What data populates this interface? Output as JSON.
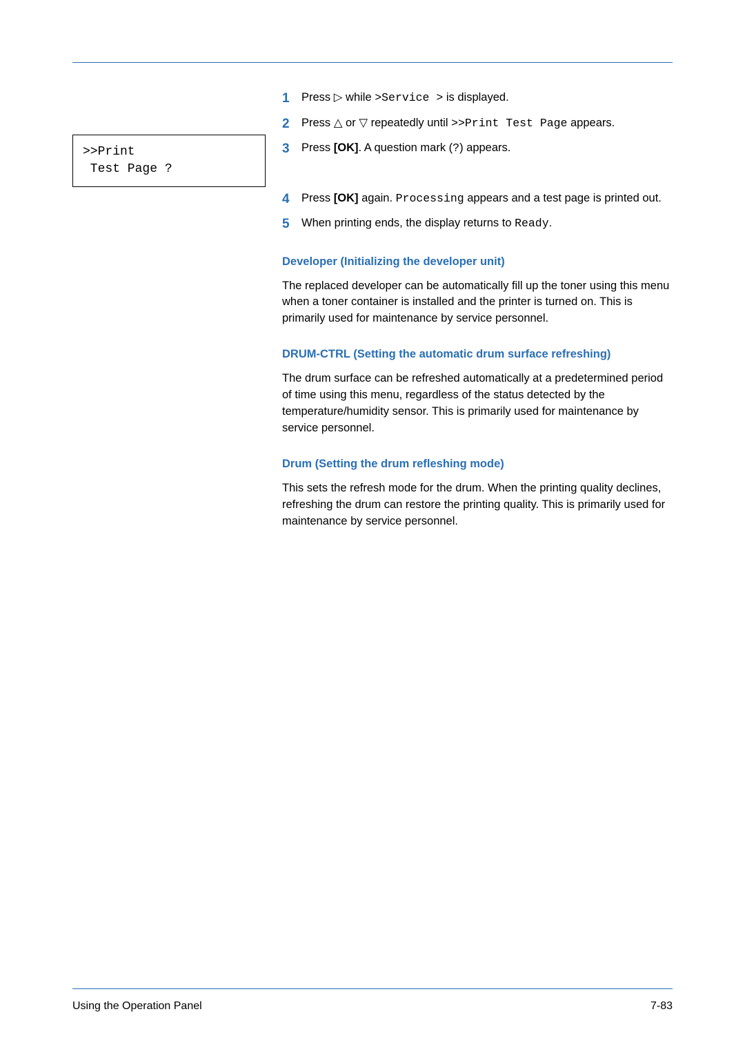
{
  "display": {
    "line1": ">>Print",
    "line2": " Test Page ?"
  },
  "steps": [
    {
      "num": "1",
      "parts": [
        "Press ",
        {
          "tri": "▷"
        },
        " while ",
        {
          "mono": ">Service >"
        },
        " is displayed."
      ]
    },
    {
      "num": "2",
      "parts": [
        "Press ",
        {
          "tri": "△"
        },
        " or ",
        {
          "tri": "▽"
        },
        " repeatedly until ",
        {
          "mono": ">>Print Test Page"
        },
        " appears."
      ]
    },
    {
      "num": "3",
      "parts": [
        "Press ",
        {
          "bold": "[OK]"
        },
        ". A question mark (",
        {
          "mono": "?"
        },
        ") appears."
      ]
    }
  ],
  "steps2": [
    {
      "num": "4",
      "parts": [
        "Press ",
        {
          "bold": "[OK]"
        },
        " again. ",
        {
          "mono": "Processing"
        },
        " appears and a test page is printed out."
      ]
    },
    {
      "num": "5",
      "parts": [
        "When printing ends, the display returns to ",
        {
          "mono": "Ready"
        },
        "."
      ]
    }
  ],
  "sections": [
    {
      "heading": "Developer (Initializing the developer unit)",
      "body": "The replaced developer can be automatically fill up the toner using this menu when a toner container is installed and the printer is turned on. This is primarily used for maintenance by service personnel."
    },
    {
      "heading": "DRUM-CTRL (Setting the automatic drum surface refreshing)",
      "body": "The drum surface can be refreshed automatically at a predetermined period of time using this menu, regardless of the status detected by the temperature/humidity sensor. This is primarily used for maintenance by service personnel."
    },
    {
      "heading": "Drum (Setting the drum refleshing mode)",
      "body": "This sets the refresh mode for the drum. When the printing quality declines, refreshing the drum can restore the printing quality. This is primarily used for maintenance by service personnel."
    }
  ],
  "footer": {
    "left": "Using the Operation Panel",
    "right": "7-83"
  }
}
